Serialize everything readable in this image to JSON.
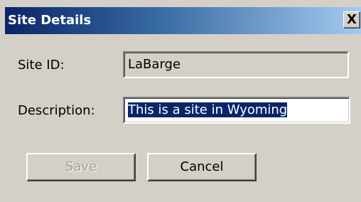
{
  "window": {
    "title": "Site Details",
    "close_glyph": "X",
    "close_icon": "close-icon"
  },
  "form": {
    "site_id_label": "Site ID:",
    "site_id_value": "LaBarge",
    "description_label": "Description:",
    "description_value": "This is a site in Wyoming"
  },
  "buttons": {
    "save_label": "Save",
    "save_enabled": false,
    "cancel_label": "Cancel"
  },
  "colors": {
    "dialog_bg": "#d4d0c8",
    "title_gradient_start": "#0a246a",
    "title_gradient_end": "#a6caf0",
    "selection_bg": "#0a246a"
  }
}
